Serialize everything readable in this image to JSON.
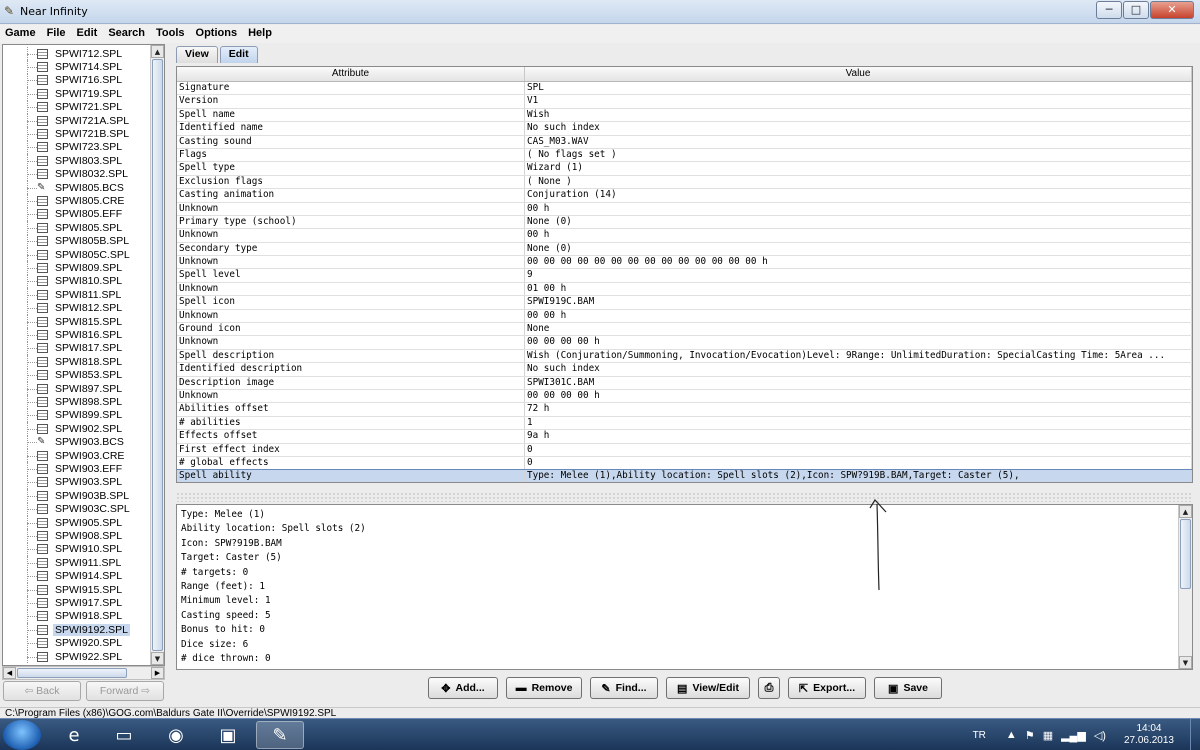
{
  "window": {
    "title": "Near Infinity",
    "minimize": "─",
    "maximize": "□",
    "close": "✕"
  },
  "menu": [
    "Game",
    "File",
    "Edit",
    "Search",
    "Tools",
    "Options",
    "Help"
  ],
  "tree": {
    "items": [
      {
        "label": "SPWI712.SPL",
        "icon": "spell-file-icon"
      },
      {
        "label": "SPWI714.SPL",
        "icon": "spell-file-icon"
      },
      {
        "label": "SPWI716.SPL",
        "icon": "spell-file-icon"
      },
      {
        "label": "SPWI719.SPL",
        "icon": "spell-file-icon"
      },
      {
        "label": "SPWI721.SPL",
        "icon": "spell-file-icon"
      },
      {
        "label": "SPWI721A.SPL",
        "icon": "spell-file-icon"
      },
      {
        "label": "SPWI721B.SPL",
        "icon": "spell-file-icon"
      },
      {
        "label": "SPWI723.SPL",
        "icon": "spell-file-icon"
      },
      {
        "label": "SPWI803.SPL",
        "icon": "spell-file-icon"
      },
      {
        "label": "SPWI8032.SPL",
        "icon": "spell-file-icon"
      },
      {
        "label": "SPWI805.BCS",
        "icon": "script-file-icon"
      },
      {
        "label": "SPWI805.CRE",
        "icon": "spell-file-icon"
      },
      {
        "label": "SPWI805.EFF",
        "icon": "spell-file-icon"
      },
      {
        "label": "SPWI805.SPL",
        "icon": "spell-file-icon"
      },
      {
        "label": "SPWI805B.SPL",
        "icon": "spell-file-icon"
      },
      {
        "label": "SPWI805C.SPL",
        "icon": "spell-file-icon"
      },
      {
        "label": "SPWI809.SPL",
        "icon": "spell-file-icon"
      },
      {
        "label": "SPWI810.SPL",
        "icon": "spell-file-icon"
      },
      {
        "label": "SPWI811.SPL",
        "icon": "spell-file-icon"
      },
      {
        "label": "SPWI812.SPL",
        "icon": "spell-file-icon"
      },
      {
        "label": "SPWI815.SPL",
        "icon": "spell-file-icon"
      },
      {
        "label": "SPWI816.SPL",
        "icon": "spell-file-icon"
      },
      {
        "label": "SPWI817.SPL",
        "icon": "spell-file-icon"
      },
      {
        "label": "SPWI818.SPL",
        "icon": "spell-file-icon"
      },
      {
        "label": "SPWI853.SPL",
        "icon": "spell-file-icon"
      },
      {
        "label": "SPWI897.SPL",
        "icon": "spell-file-icon"
      },
      {
        "label": "SPWI898.SPL",
        "icon": "spell-file-icon"
      },
      {
        "label": "SPWI899.SPL",
        "icon": "spell-file-icon"
      },
      {
        "label": "SPWI902.SPL",
        "icon": "spell-file-icon"
      },
      {
        "label": "SPWI903.BCS",
        "icon": "script-file-icon"
      },
      {
        "label": "SPWI903.CRE",
        "icon": "spell-file-icon"
      },
      {
        "label": "SPWI903.EFF",
        "icon": "spell-file-icon"
      },
      {
        "label": "SPWI903.SPL",
        "icon": "spell-file-icon"
      },
      {
        "label": "SPWI903B.SPL",
        "icon": "spell-file-icon"
      },
      {
        "label": "SPWI903C.SPL",
        "icon": "spell-file-icon"
      },
      {
        "label": "SPWI905.SPL",
        "icon": "spell-file-icon"
      },
      {
        "label": "SPWI908.SPL",
        "icon": "spell-file-icon"
      },
      {
        "label": "SPWI910.SPL",
        "icon": "spell-file-icon"
      },
      {
        "label": "SPWI911.SPL",
        "icon": "spell-file-icon"
      },
      {
        "label": "SPWI914.SPL",
        "icon": "spell-file-icon"
      },
      {
        "label": "SPWI915.SPL",
        "icon": "spell-file-icon"
      },
      {
        "label": "SPWI917.SPL",
        "icon": "spell-file-icon"
      },
      {
        "label": "SPWI918.SPL",
        "icon": "spell-file-icon"
      },
      {
        "label": "SPWI9192.SPL",
        "icon": "spell-file-icon",
        "selected": true
      },
      {
        "label": "SPWI920.SPL",
        "icon": "spell-file-icon"
      },
      {
        "label": "SPWI922.SPL",
        "icon": "spell-file-icon"
      }
    ]
  },
  "nav": {
    "back": "⇦ Back",
    "forward": "Forward ⇨"
  },
  "tabs": [
    {
      "label": "View",
      "active": false
    },
    {
      "label": "Edit",
      "active": true
    }
  ],
  "table": {
    "headers": {
      "attribute": "Attribute",
      "value": "Value"
    },
    "rows": [
      [
        "Signature",
        "SPL"
      ],
      [
        "Version",
        "V1"
      ],
      [
        "Spell name",
        "Wish"
      ],
      [
        "Identified name",
        "No such index"
      ],
      [
        "Casting sound",
        "CAS_M03.WAV"
      ],
      [
        "Flags",
        "( No flags set )"
      ],
      [
        "Spell type",
        "Wizard (1)"
      ],
      [
        "Exclusion flags",
        "( None )"
      ],
      [
        "Casting animation",
        "Conjuration (14)"
      ],
      [
        "Unknown",
        "00 h"
      ],
      [
        "Primary type (school)",
        "None (0)"
      ],
      [
        "Unknown",
        "00 h"
      ],
      [
        "Secondary type",
        "None (0)"
      ],
      [
        "Unknown",
        "00 00 00 00 00 00 00 00 00 00 00 00 00 00 h"
      ],
      [
        "Spell level",
        "9"
      ],
      [
        "Unknown",
        "01 00 h"
      ],
      [
        "Spell icon",
        "SPWI919C.BAM"
      ],
      [
        "Unknown",
        "00 00 h"
      ],
      [
        "Ground icon",
        "None"
      ],
      [
        "Unknown",
        "00 00 00 00 h"
      ],
      [
        "Spell description",
        "Wish (Conjuration/Summoning, Invocation/Evocation)Level: 9Range: UnlimitedDuration: SpecialCasting Time: 5Area ..."
      ],
      [
        "Identified description",
        "No such index"
      ],
      [
        "Description image",
        "SPWI301C.BAM"
      ],
      [
        "Unknown",
        "00 00 00 00 h"
      ],
      [
        "Abilities offset",
        "72 h"
      ],
      [
        "# abilities",
        "1"
      ],
      [
        "Effects offset",
        "9a h"
      ],
      [
        "First effect index",
        "0"
      ],
      [
        "# global effects",
        "0"
      ],
      [
        "Spell ability",
        "Type: Melee (1),Ability location: Spell slots (2),Icon: SPW?919B.BAM,Target: Caster (5),"
      ]
    ],
    "selected_row": 29
  },
  "detail": {
    "lines": [
      "Type: Melee (1)",
      "Ability location: Spell slots (2)",
      "Icon: SPW?919B.BAM",
      "Target: Caster (5)",
      "# targets: 0",
      "Range (feet): 1",
      "Minimum level: 1",
      "Casting speed: 5",
      "Bonus to hit: 0",
      "Dice size: 6",
      "# dice thrown: 0"
    ]
  },
  "buttons": [
    {
      "label": "Add...",
      "icon": "✥",
      "name": "add-button"
    },
    {
      "label": "Remove",
      "icon": "▬",
      "name": "remove-button"
    },
    {
      "label": "Find...",
      "icon": "✎",
      "name": "find-button"
    },
    {
      "label": "View/Edit",
      "icon": "▤",
      "name": "view-edit-button"
    },
    {
      "label": "",
      "icon": "⎙",
      "name": "print-button"
    },
    {
      "label": "Export...",
      "icon": "⇱",
      "name": "export-button"
    },
    {
      "label": "Save",
      "icon": "▣",
      "name": "save-button"
    }
  ],
  "status": "C:\\Program Files (x86)\\GOG.com\\Baldurs Gate II\\Override\\SPWI9192.SPL",
  "taskbar": {
    "tray_lang": "TR",
    "time": "14:04",
    "date": "27.06.2013"
  }
}
